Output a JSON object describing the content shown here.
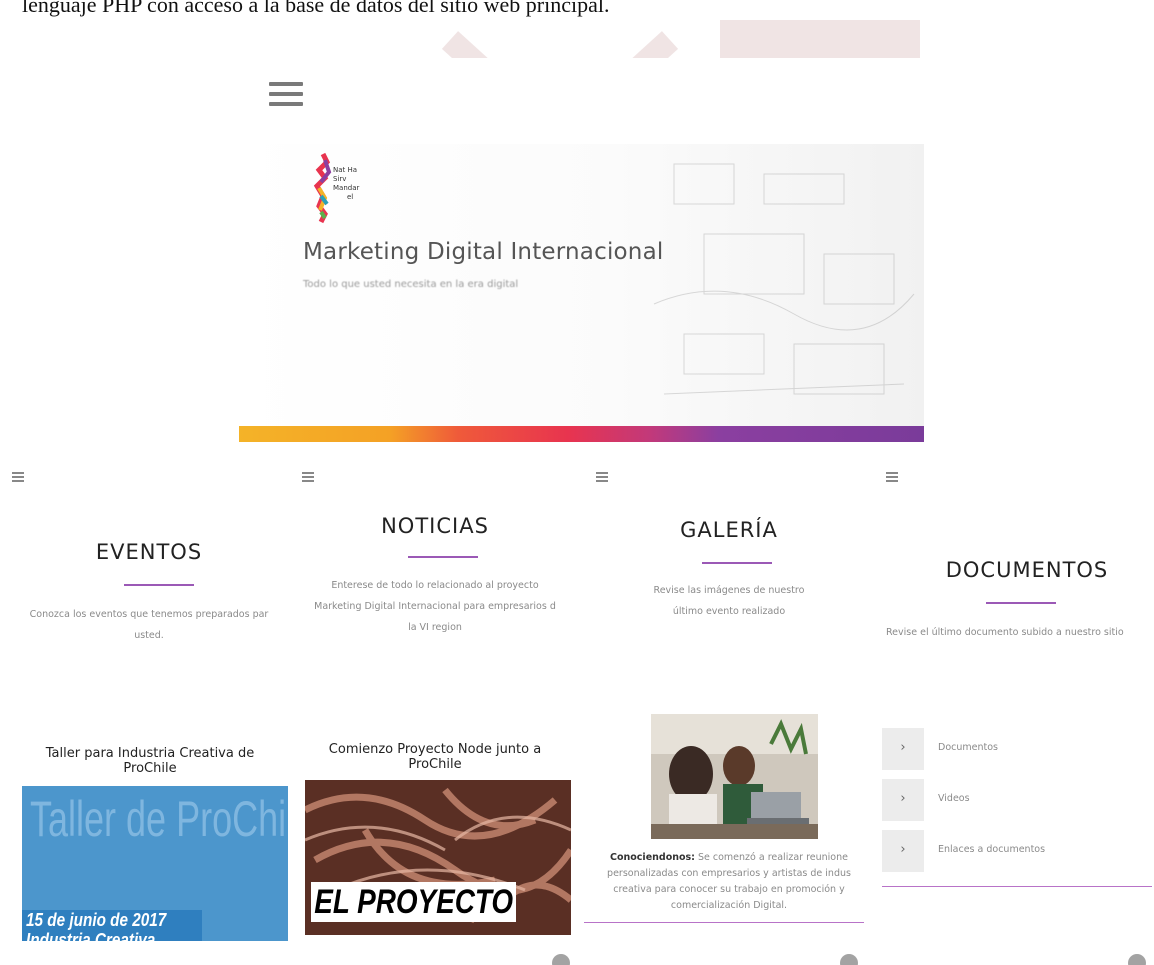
{
  "caption": "lenguaje PHP con acceso a la base de datos del sitio web principal.",
  "hero": {
    "logo_text": [
      "Nat Ha",
      "Sirv",
      "Mandar",
      "el"
    ],
    "title": "Marketing Digital Internacional",
    "subtitle": "Todo lo que usted necesita en la era digital"
  },
  "colors": {
    "accent": "#9b59b6",
    "strip": [
      "#f4b328",
      "#ef5a3a",
      "#e8344f",
      "#7a3b9a"
    ]
  },
  "eventos": {
    "title": "EVENTOS",
    "desc": [
      "Conozca los eventos que tenemos preparados par",
      "usted."
    ],
    "card_title": [
      "Taller para Industria Creativa de",
      "ProChile"
    ],
    "image": {
      "big": "Taller de ProChile",
      "line1": "15 de junio de 2017",
      "line2": "Industria Creativa"
    }
  },
  "noticias": {
    "title": "NOTICIAS",
    "desc": [
      "Enterese de todo lo relacionado al proyecto",
      "Marketing Digital Internacional para empresarios d",
      "la VI region"
    ],
    "card_title": [
      "Comienzo Proyecto Node junto a",
      "ProChile"
    ],
    "image": {
      "label": "EL PROYECTO"
    }
  },
  "galeria": {
    "title": "GALERÍA",
    "desc": [
      "Revise las imágenes de nuestro",
      "último evento realizado"
    ],
    "caption_bold": "Conociendonos:",
    "caption_lines": [
      " Se comenzó a realizar reunione",
      "personalizadas con empresarios y artistas de indus",
      "creativa para conocer su trabajo en promoción y",
      "comercialización Digital."
    ]
  },
  "documentos": {
    "title": "DOCUMENTOS",
    "desc": "Revise el último documento subido a nuestro sitio",
    "items": [
      {
        "chevron": "›",
        "label": "Documentos"
      },
      {
        "chevron": "›",
        "label": "Videos"
      },
      {
        "chevron": "›",
        "label": "Enlaces a documentos"
      }
    ]
  }
}
